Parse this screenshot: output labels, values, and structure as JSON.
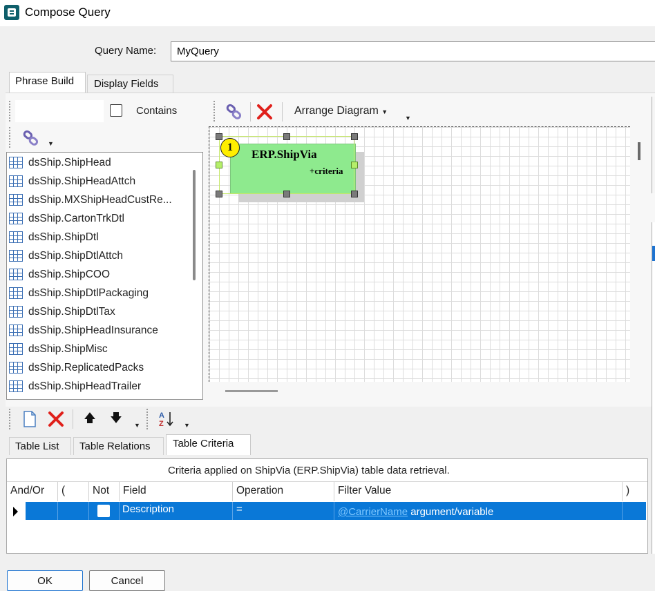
{
  "window": {
    "title": "Compose Query"
  },
  "query": {
    "label": "Query Name:",
    "value": "MyQuery"
  },
  "top_tabs": [
    {
      "label": "Phrase Build",
      "active": true
    },
    {
      "label": "Display Fields",
      "active": false
    }
  ],
  "search": {
    "value": "",
    "contains_label": "Contains",
    "contains_checked": false
  },
  "table_list": [
    "dsShip.ShipHead",
    "dsShip.ShipHeadAttch",
    "dsShip.MXShipHeadCustRe...",
    "dsShip.CartonTrkDtl",
    "dsShip.ShipDtl",
    "dsShip.ShipDtlAttch",
    "dsShip.ShipCOO",
    "dsShip.ShipDtlPackaging",
    "dsShip.ShipDtlTax",
    "dsShip.ShipHeadInsurance",
    "dsShip.ShipMisc",
    "dsShip.ReplicatedPacks",
    "dsShip.ShipHeadTrailer"
  ],
  "diagram_toolbar": {
    "arrange_label": "Arrange Diagram"
  },
  "diagram": {
    "entity": {
      "badge": "1",
      "title": "ERP.ShipVia",
      "subtitle": "+criteria"
    }
  },
  "bottom_tabs": [
    {
      "label": "Table List",
      "active": false
    },
    {
      "label": "Table Relations",
      "active": false
    },
    {
      "label": "Table Criteria",
      "active": true
    }
  ],
  "criteria": {
    "caption": "Criteria applied on ShipVia (ERP.ShipVia)  table data retrieval.",
    "columns": [
      "And/Or",
      "(",
      "Not",
      "Field",
      "Operation",
      "Filter Value",
      ")"
    ],
    "row": {
      "and_or": "",
      "open_paren": "",
      "not_checked": false,
      "field": "Description",
      "operation": "=",
      "filter_link": "@CarrierName",
      "filter_suffix": "argument/variable",
      "close_paren": ""
    }
  },
  "footer": {
    "ok_label": "OK",
    "cancel_label": "Cancel"
  },
  "colors": {
    "selection": "#0a78d7",
    "entity_fill": "#8eea8e",
    "badge": "#ffee00",
    "delete_red": "#e0201b"
  }
}
